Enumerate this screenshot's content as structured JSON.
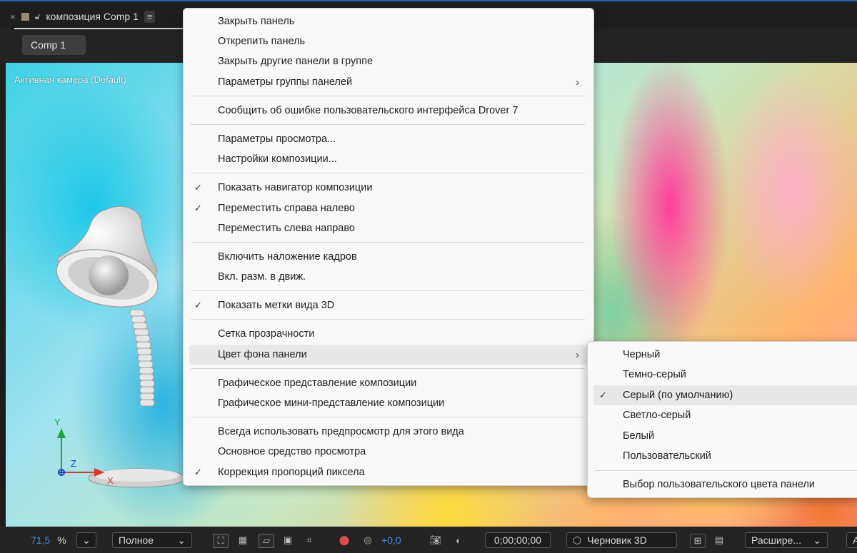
{
  "tab": {
    "close_glyph": "×",
    "title": "композиция Comp 1",
    "menu_glyph": "≡"
  },
  "comp_chip": "Comp 1",
  "viewer": {
    "camera_label": "Активная камера (Default)",
    "axis_y": "Y",
    "axis_z": "Z",
    "axis_x": "X"
  },
  "context_menu": {
    "items": [
      {
        "label": "Закрыть панель",
        "checked": false,
        "submenu": false
      },
      {
        "label": "Открепить панель",
        "checked": false,
        "submenu": false
      },
      {
        "label": "Закрыть другие панели в группе",
        "checked": false,
        "submenu": false
      },
      {
        "label": "Параметры группы панелей",
        "checked": false,
        "submenu": true
      },
      {
        "label": "Сообщить об ошибке пользовательского интерфейса Drover 7",
        "checked": false,
        "submenu": false
      },
      {
        "label": "Параметры просмотра...",
        "checked": false,
        "submenu": false
      },
      {
        "label": "Настройки композиции...",
        "checked": false,
        "submenu": false
      },
      {
        "label": "Показать навигатор композиции",
        "checked": true,
        "submenu": false
      },
      {
        "label": "Переместить справа налево",
        "checked": true,
        "submenu": false
      },
      {
        "label": "Переместить слева направо",
        "checked": false,
        "submenu": false
      },
      {
        "label": "Включить наложение кадров",
        "checked": false,
        "submenu": false
      },
      {
        "label": "Вкл. разм. в движ.",
        "checked": false,
        "submenu": false
      },
      {
        "label": "Показать метки вида 3D",
        "checked": true,
        "submenu": false
      },
      {
        "label": "Сетка прозрачности",
        "checked": false,
        "submenu": false
      },
      {
        "label": "Цвет фона панели",
        "checked": false,
        "submenu": true,
        "highlighted": true
      },
      {
        "label": "Графическое представление композиции",
        "checked": false,
        "submenu": false
      },
      {
        "label": "Графическое мини-представление композиции",
        "checked": false,
        "submenu": false
      },
      {
        "label": "Всегда использовать предпросмотр для этого вида",
        "checked": false,
        "submenu": false
      },
      {
        "label": "Основное средство просмотра",
        "checked": false,
        "submenu": false
      },
      {
        "label": "Коррекция пропорций пиксела",
        "checked": true,
        "submenu": false
      }
    ],
    "check_glyph": "✓",
    "arrow_glyph": "›"
  },
  "bg_color_submenu": {
    "items": [
      {
        "label": "Черный",
        "checked": false
      },
      {
        "label": "Темно-серый",
        "checked": false
      },
      {
        "label": "Серый (по умолчанию)",
        "checked": true
      },
      {
        "label": "Светло-серый",
        "checked": false
      },
      {
        "label": "Белый",
        "checked": false
      },
      {
        "label": "Пользовательский",
        "checked": false
      },
      {
        "label": "Выбор пользовательского цвета панели",
        "checked": false
      }
    ]
  },
  "bottom_bar": {
    "zoom_value": "71,5",
    "zoom_unit": "%",
    "resolution": "Полное",
    "exposure": "+0,0",
    "timecode": "0;00;00;00",
    "renderer": "Черновик 3D",
    "view_mode": "Расшире...",
    "last_cut": "А"
  },
  "colors": {
    "accent": "#2d5fb5",
    "exposure_blue": "#3d8fe0",
    "menu_bg": "#f9f9f9",
    "menu_highlight": "#e8e8e8"
  }
}
